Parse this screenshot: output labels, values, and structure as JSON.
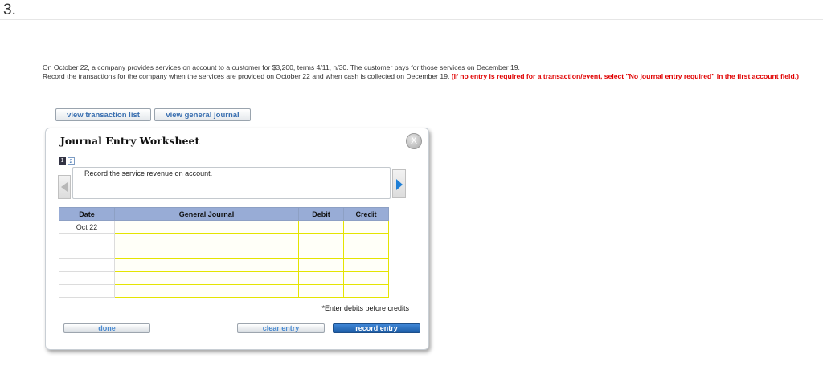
{
  "question_number": "3.",
  "problem": {
    "line1": "On October 22, a company provides services on account to a customer for $3,200, terms 4/11, n/30. The customer pays for those services on December 19.",
    "line2": "Record the transactions for the company when the services are provided on October 22 and when cash is collected on December 19.",
    "warning": "(If no entry is required for a transaction/event, select \"No journal entry required\" in the first account field.)"
  },
  "top_buttons": {
    "transaction_list": "view transaction list",
    "general_journal": "view general journal"
  },
  "worksheet": {
    "title": "Journal Entry Worksheet",
    "close_glyph": "X",
    "pages": [
      "1",
      "2"
    ],
    "active_page": "1",
    "instruction": "Record the service revenue on account.",
    "table": {
      "headers": [
        "Date",
        "General Journal",
        "Debit",
        "Credit"
      ],
      "rows": [
        {
          "date": "Oct 22",
          "account": "",
          "debit": "",
          "credit": ""
        },
        {
          "date": "",
          "account": "",
          "debit": "",
          "credit": ""
        },
        {
          "date": "",
          "account": "",
          "debit": "",
          "credit": ""
        },
        {
          "date": "",
          "account": "",
          "debit": "",
          "credit": ""
        },
        {
          "date": "",
          "account": "",
          "debit": "",
          "credit": ""
        },
        {
          "date": "",
          "account": "",
          "debit": "",
          "credit": ""
        }
      ]
    },
    "note": "*Enter debits before credits",
    "buttons": {
      "done": "done",
      "clear": "clear entry",
      "record": "record entry"
    }
  },
  "colors": {
    "header_bg": "#98acd6",
    "field_border": "#e4e400",
    "warning_text": "#e00000",
    "primary_button": "#1e5ea8"
  }
}
